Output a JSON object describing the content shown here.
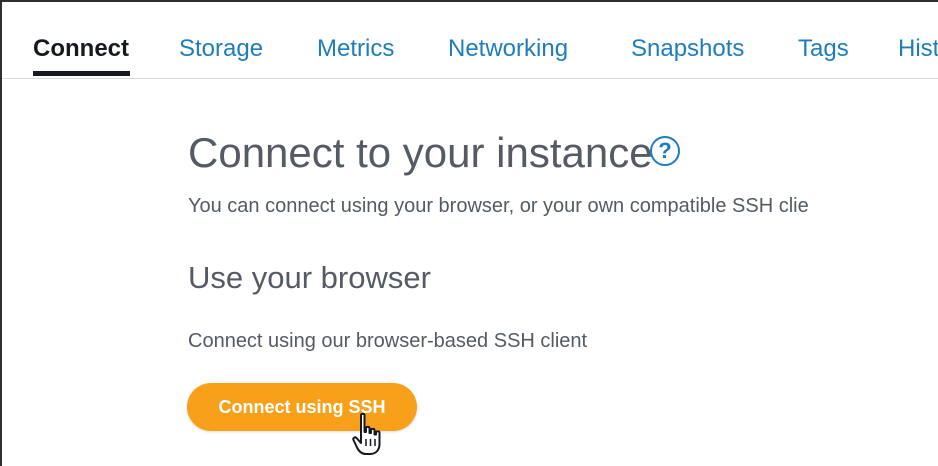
{
  "tabs": [
    {
      "label": "Connect",
      "active": true
    },
    {
      "label": "Storage",
      "active": false
    },
    {
      "label": "Metrics",
      "active": false
    },
    {
      "label": "Networking",
      "active": false
    },
    {
      "label": "Snapshots",
      "active": false
    },
    {
      "label": "Tags",
      "active": false
    },
    {
      "label": "Hist",
      "active": false
    }
  ],
  "main": {
    "heading": "Connect to your instance",
    "help_icon_glyph": "?",
    "subtext": "You can connect using your browser, or your own compatible SSH clie",
    "section_title": "Use your browser",
    "section_desc": "Connect using our browser-based SSH client",
    "connect_button_label": "Connect using SSH"
  },
  "colors": {
    "accent_link": "#1e7dbb",
    "button": "#f9a01b",
    "text": "#545b64",
    "active_tab": "#16191f"
  },
  "icons": [
    "help-icon",
    "hand-pointer-cursor-icon"
  ]
}
